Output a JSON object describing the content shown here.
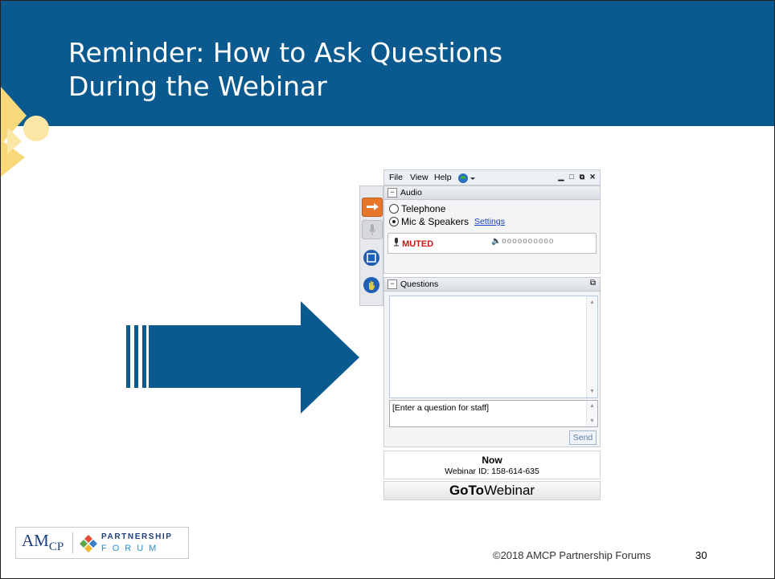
{
  "slide": {
    "title_line1": "Reminder: How to Ask Questions",
    "title_line2": "During the Webinar",
    "footer": "©2018 AMCP Partnership Forums",
    "page_number": "30"
  },
  "colors": {
    "header_bg": "#0b5a8f",
    "accent_yellow": "#f8d97a",
    "arrow": "#0b5a8f",
    "muted_red": "#d01616"
  },
  "logo": {
    "amcp": "AMCP",
    "partnership": "PARTNERSHIP",
    "forum": "FORUM"
  },
  "webinar": {
    "menu": {
      "file": "File",
      "view": "View",
      "help": "Help"
    },
    "audio": {
      "header": "Audio",
      "telephone": "Telephone",
      "mic": "Mic & Speakers",
      "settings": "Settings",
      "muted": "MUTED",
      "selected": "Mic & Speakers"
    },
    "questions": {
      "header": "Questions",
      "placeholder": "[Enter a question for staff]",
      "send": "Send"
    },
    "status": {
      "now": "Now",
      "webinar_id": "Webinar ID: 158-614-635"
    },
    "brand_bold": "GoTo",
    "brand_rest": "Webinar",
    "icons": [
      "arrow-right-icon",
      "microphone-icon",
      "screen-icon",
      "raise-hand-icon",
      "globe-icon"
    ]
  }
}
